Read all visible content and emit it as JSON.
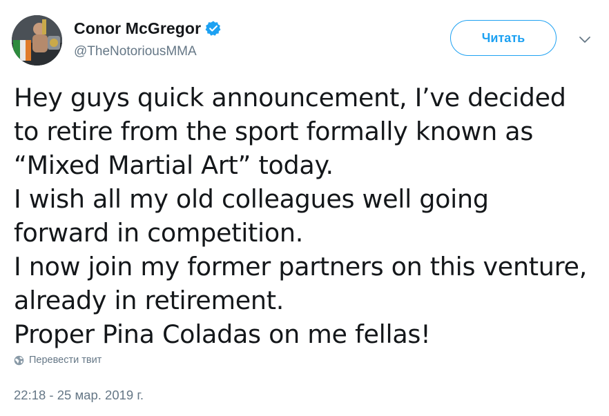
{
  "author": {
    "display_name": "Conor McGregor",
    "handle": "@TheNotoriousMMA",
    "verified": true
  },
  "follow_button": {
    "label": "Читать"
  },
  "tweet": {
    "lines": [
      "Hey guys quick announcement, I’ve decided",
      "to retire from the sport formally known as",
      "“Mixed Martial Art” today.",
      "I wish all my old colleagues well going",
      "forward in competition.",
      "I now join my former partners on this venture,",
      "already in retirement.",
      "Proper Pina Coladas on me fellas!"
    ],
    "translate_label": "Перевести твит",
    "timestamp": "22:18 - 25 мар. 2019 г."
  },
  "icons": {
    "verified": "verified-badge-icon",
    "caret": "chevron-down-icon",
    "globe": "globe-icon"
  },
  "colors": {
    "accent": "#1da1f2",
    "text": "#14171a",
    "secondary": "#657786"
  }
}
